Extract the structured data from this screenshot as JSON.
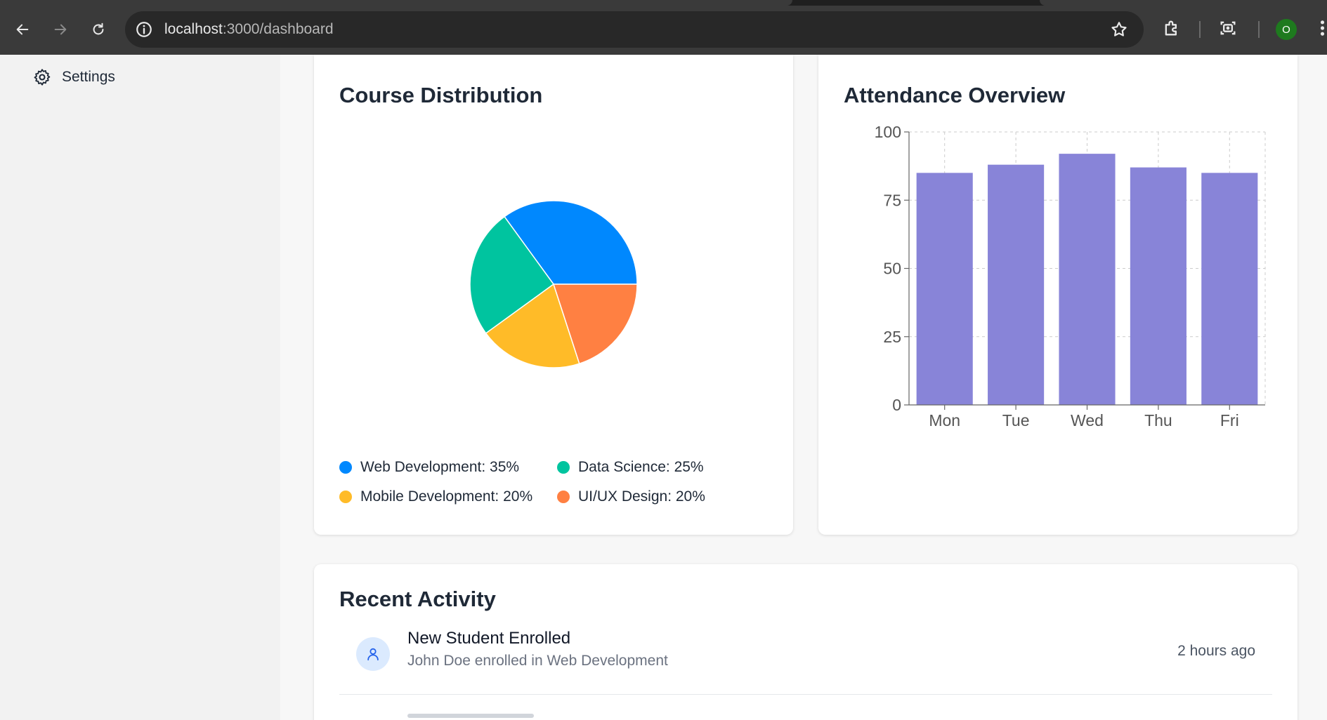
{
  "browser": {
    "url_host": "localhost",
    "url_path": ":3000/dashboard",
    "profile_initial": "O",
    "icons": [
      "back-icon",
      "forward-icon",
      "reload-icon",
      "info-icon",
      "star-icon",
      "extensions-icon",
      "screenshot-icon",
      "more-icon"
    ]
  },
  "sidebar": {
    "items": [
      {
        "label": "Settings",
        "icon": "gear-icon"
      }
    ]
  },
  "course_card": {
    "title": "Course Distribution"
  },
  "attendance_card": {
    "title": "Attendance Overview"
  },
  "activity_card": {
    "title": "Recent Activity",
    "items": [
      {
        "title": "New Student Enrolled",
        "description": "John Doe enrolled in Web Development",
        "time": "2 hours ago",
        "icon": "user-icon"
      }
    ]
  },
  "chart_data": [
    {
      "type": "pie",
      "title": "Course Distribution",
      "slices": [
        {
          "label": "Web Development",
          "value": 35,
          "color": "#0088FE",
          "legend": "Web Development: 35%"
        },
        {
          "label": "Data Science",
          "value": 25,
          "color": "#00C49F",
          "legend": "Data Science: 25%"
        },
        {
          "label": "Mobile Development",
          "value": 20,
          "color": "#FFBB28",
          "legend": "Mobile Development: 20%"
        },
        {
          "label": "UI/UX Design",
          "value": 20,
          "color": "#FF8042",
          "legend": "UI/UX Design: 20%"
        }
      ],
      "legend_placement": "bottom"
    },
    {
      "type": "bar",
      "title": "Attendance Overview",
      "categories": [
        "Mon",
        "Tue",
        "Wed",
        "Thu",
        "Fri"
      ],
      "values": [
        85,
        88,
        92,
        87,
        85
      ],
      "color": "#8884d8",
      "ylim": [
        0,
        100
      ],
      "yticks": [
        0,
        25,
        50,
        75,
        100
      ],
      "grid": true,
      "xlabel": "",
      "ylabel": ""
    }
  ]
}
